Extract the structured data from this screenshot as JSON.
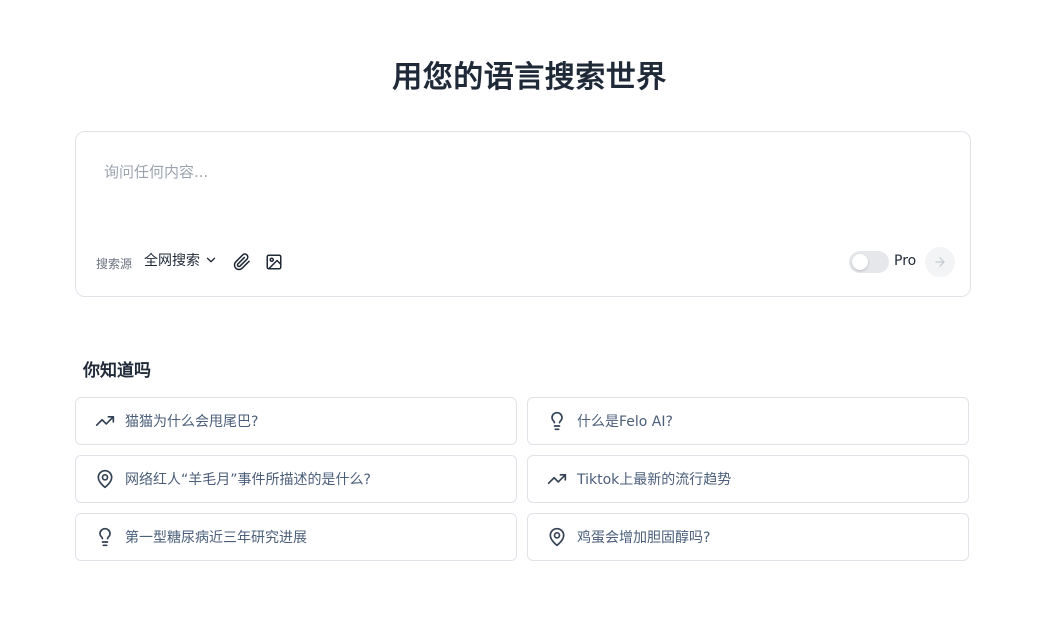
{
  "header": {
    "title": "用您的语言搜索世界"
  },
  "search": {
    "placeholder": "询问任何内容...",
    "source_label": "搜索源",
    "source_value": "全网搜索",
    "pro_label": "Pro"
  },
  "suggestions": {
    "title": "你知道吗",
    "items": [
      {
        "icon": "trending-up-icon",
        "text": "猫猫为什么会甩尾巴?"
      },
      {
        "icon": "lightbulb-icon",
        "text": "什么是Felo AI?"
      },
      {
        "icon": "map-pin-icon",
        "text": "网络红人“羊毛月”事件所描述的是什么?"
      },
      {
        "icon": "trending-up-icon",
        "text": "Tiktok上最新的流行趋势"
      },
      {
        "icon": "lightbulb-icon",
        "text": "第一型糖尿病近三年研究进展"
      },
      {
        "icon": "map-pin-icon",
        "text": "鸡蛋会增加胆固醇吗?"
      }
    ]
  },
  "colors": {
    "text": "#1f2937",
    "muted": "#9ca3af",
    "border": "#dfe3e8"
  }
}
